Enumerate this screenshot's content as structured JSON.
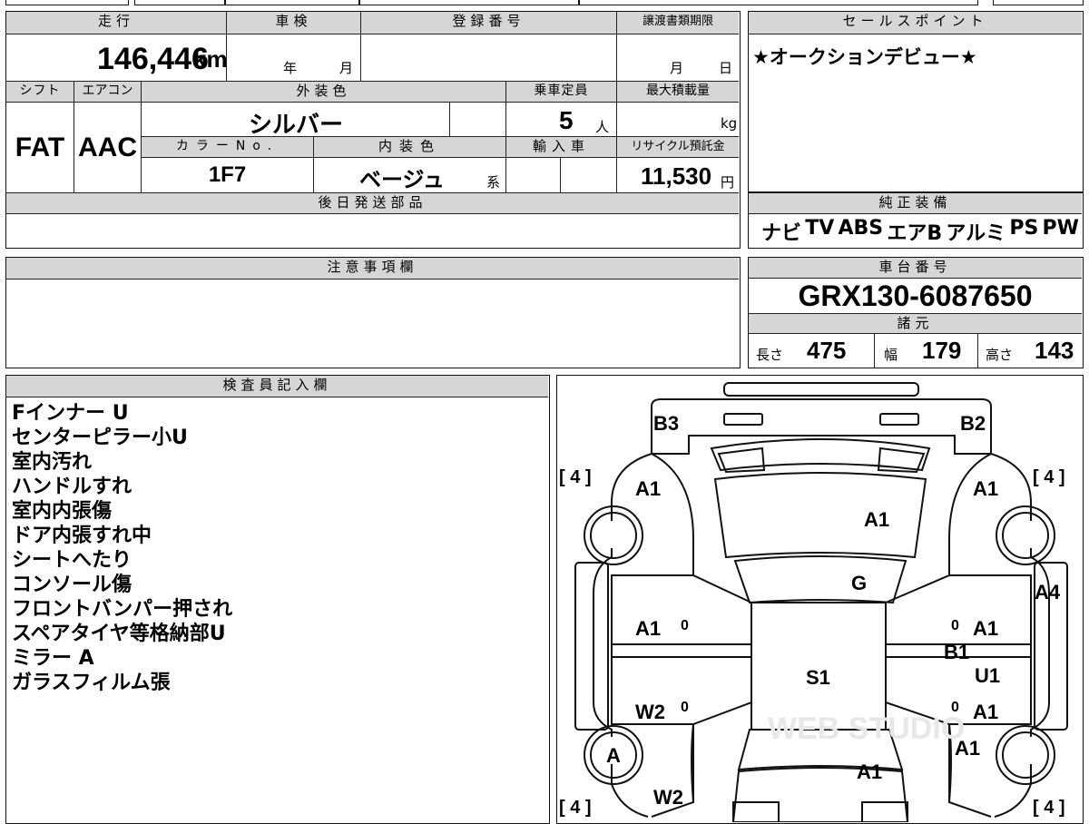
{
  "odometer": {
    "label": "走行",
    "value": "146,446",
    "unit": "km"
  },
  "inspection": {
    "label": "車検",
    "year_unit": "年",
    "month_unit": "月"
  },
  "registration": {
    "label": "登録番号",
    "value": ""
  },
  "transfer_deadline": {
    "label": "譲渡書類期限",
    "month_unit": "月",
    "day_unit": "日"
  },
  "sales_point": {
    "label": "セールスポイント",
    "text": "★オークションデビュー★"
  },
  "shift": {
    "label": "シフト",
    "value": "FAT"
  },
  "aircon": {
    "label": "エアコン",
    "value": "AAC"
  },
  "exterior_color": {
    "label": "外装色",
    "value": "シルバー"
  },
  "capacity": {
    "label": "乗車定員",
    "value": "5",
    "unit": "人"
  },
  "max_load": {
    "label": "最大積載量",
    "unit": "kg"
  },
  "color_no": {
    "label": "カラーNo.",
    "value": "1F7"
  },
  "interior_color": {
    "label": "内装色",
    "value": "ベージュ",
    "suffix": "系"
  },
  "import": {
    "label": "輸入車"
  },
  "recycle": {
    "label": "リサイクル預託金",
    "value": "11,530",
    "unit": "円"
  },
  "later_parts": {
    "label": "後日発送部品"
  },
  "equipment": {
    "label": "純正装備",
    "items": [
      "ナビ",
      "TV",
      "ABS",
      "エアB",
      "アルミ",
      "PS",
      "PW"
    ]
  },
  "caution": {
    "label": "注意事項欄"
  },
  "chassis": {
    "label": "車台番号",
    "value": "GRX130-6087650"
  },
  "specs": {
    "label": "諸元",
    "length": {
      "label": "長さ",
      "value": "475"
    },
    "width": {
      "label": "幅",
      "value": "179"
    },
    "height": {
      "label": "高さ",
      "value": "143"
    }
  },
  "inspector": {
    "label": "検査員記入欄",
    "notes": [
      "Fインナー U",
      "センターピラー小U",
      "室内汚れ",
      "ハンドルすれ",
      "室内内張傷",
      "ドア内張すれ中",
      "シートへたり",
      "コンソール傷",
      "フロントバンパー押され",
      "スペアタイヤ等格納部U",
      "ミラー A",
      "ガラスフィルム張"
    ]
  },
  "diagram": {
    "tire_labels": [
      "[ 4 ]",
      "[ 4 ]",
      "[ 4 ]",
      "[ 4 ]"
    ],
    "marks": [
      "B3",
      "B2",
      "A1",
      "A1",
      "A1",
      "G",
      "A4",
      "A1",
      "A1",
      "B1",
      "S1",
      "U1",
      "W2",
      "A1",
      "A",
      "A1",
      "A1",
      "W2"
    ],
    "zeros": [
      "0",
      "0",
      "0",
      "0"
    ],
    "watermark": "WEB STUDIO"
  }
}
